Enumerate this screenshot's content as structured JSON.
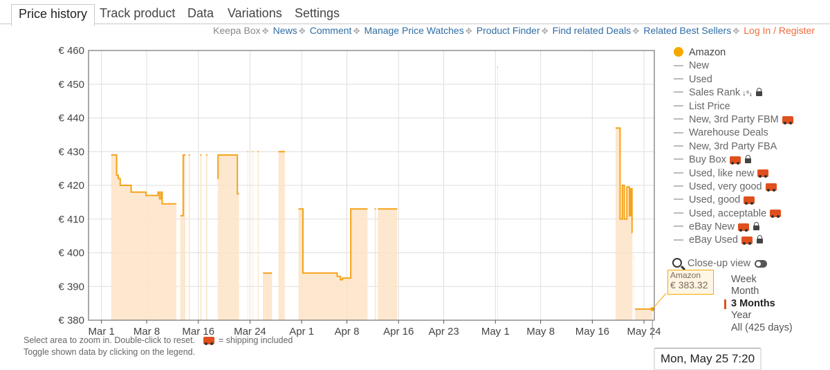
{
  "tabs": [
    "Price history",
    "Track product",
    "Data",
    "Variations",
    "Settings"
  ],
  "links": {
    "keepa_box": "Keepa Box",
    "items": [
      "News",
      "Comment",
      "Manage Price Watches",
      "Product Finder",
      "Find related Deals",
      "Related Best Sellers"
    ],
    "login": "Log In / Register"
  },
  "legend": {
    "items": [
      {
        "label": "Amazon",
        "selected": true
      },
      {
        "label": "New"
      },
      {
        "label": "Used"
      },
      {
        "label": "Sales Rank",
        "sort_icon": true,
        "lock": true
      },
      {
        "label": "List Price"
      },
      {
        "label": "New, 3rd Party FBM",
        "truck": true
      },
      {
        "label": "Warehouse Deals"
      },
      {
        "label": "New, 3rd Party FBA"
      },
      {
        "label": "Buy Box",
        "truck": true,
        "lock": true
      },
      {
        "label": "Used, like new",
        "truck": true
      },
      {
        "label": "Used, very good",
        "truck": true
      },
      {
        "label": "Used, good",
        "truck": true
      },
      {
        "label": "Used, acceptable",
        "truck": true
      },
      {
        "label": "eBay New",
        "truck": true,
        "lock": true
      },
      {
        "label": "eBay Used",
        "truck": true,
        "lock": true
      }
    ],
    "closeup_label": "Close-up view"
  },
  "ranges": {
    "items": [
      "Week",
      "Month",
      "3 Months",
      "Year",
      "All (425 days)"
    ],
    "selected": "3 Months"
  },
  "hints": {
    "line1a": "Select area to zoom in. Double-click to reset.",
    "line1b": "= shipping included",
    "line2": "Toggle shown data by clicking on the legend."
  },
  "tooltip": {
    "series": "Amazon",
    "value": "€ 383.32"
  },
  "crosshair_date": "Mon, May 25 7:20",
  "colors": {
    "amazon_line": "#f5a31a",
    "amazon_fill": "#fde3c6",
    "grid": "#dedede",
    "link": "#2f6da4",
    "login": "#ef6b3a"
  },
  "chart_data": {
    "type": "area",
    "series_name": "Amazon",
    "y_unit": "€",
    "ylim": [
      380,
      460
    ],
    "y_ticks": [
      "€ 460",
      "€ 450",
      "€ 440",
      "€ 430",
      "€ 420",
      "€ 410",
      "€ 400",
      "€ 390",
      "€ 380"
    ],
    "y_tick_values": [
      460,
      450,
      440,
      430,
      420,
      410,
      400,
      390,
      380
    ],
    "x_ticks": [
      {
        "label": "Mar 1",
        "day": 0
      },
      {
        "label": "Mar 8",
        "day": 7
      },
      {
        "label": "Mar 16",
        "day": 15
      },
      {
        "label": "Mar 24",
        "day": 23
      },
      {
        "label": "Apr 1",
        "day": 31
      },
      {
        "label": "Apr 8",
        "day": 38
      },
      {
        "label": "Apr 16",
        "day": 46
      },
      {
        "label": "Apr 23",
        "day": 53
      },
      {
        "label": "May 1",
        "day": 61
      },
      {
        "label": "May 8",
        "day": 68
      },
      {
        "label": "May 16",
        "day": 76
      },
      {
        "label": "May 24",
        "day": 84
      }
    ],
    "x_domain_days": [
      -2,
      85.6
    ],
    "segments": [
      [
        [
          1.5,
          429
        ],
        [
          2.3,
          429
        ],
        [
          2.35,
          423
        ],
        [
          2.6,
          422
        ],
        [
          2.9,
          420
        ],
        [
          4.5,
          420
        ],
        [
          4.6,
          418
        ],
        [
          6.8,
          418
        ],
        [
          6.9,
          417
        ],
        [
          8.1,
          417
        ]
      ],
      [
        [
          8.1,
          417
        ],
        [
          8.7,
          417
        ],
        [
          8.75,
          418
        ],
        [
          8.95,
          418
        ],
        [
          9.0,
          416
        ],
        [
          9.2,
          416
        ],
        [
          9.25,
          418
        ],
        [
          9.35,
          418
        ],
        [
          9.4,
          414.5
        ],
        [
          11.6,
          414.5
        ]
      ],
      [
        [
          12.2,
          411
        ],
        [
          12.6,
          411
        ],
        [
          12.65,
          429
        ],
        [
          13.0,
          429
        ]
      ],
      [
        [
          13.5,
          429
        ],
        [
          13.7,
          429
        ]
      ],
      [
        [
          15.3,
          429
        ],
        [
          15.5,
          429
        ]
      ],
      [
        [
          16.2,
          429
        ],
        [
          16.4,
          429
        ]
      ],
      [
        [
          18.0,
          422
        ],
        [
          18.05,
          429
        ],
        [
          21.0,
          429
        ],
        [
          21.05,
          417.5
        ],
        [
          21.3,
          417.5
        ]
      ],
      [
        [
          22.6,
          430
        ],
        [
          22.7,
          430
        ]
      ],
      [
        [
          23.4,
          430
        ],
        [
          23.5,
          430
        ]
      ],
      [
        [
          24.2,
          430
        ],
        [
          24.35,
          430
        ]
      ],
      [
        [
          25.0,
          394
        ],
        [
          26.4,
          394
        ]
      ],
      [
        [
          27.4,
          430
        ],
        [
          28.4,
          430
        ]
      ],
      [
        [
          30.5,
          413
        ],
        [
          31.1,
          413
        ],
        [
          31.2,
          394
        ],
        [
          36.4,
          394
        ],
        [
          36.5,
          393
        ],
        [
          37.0,
          392
        ],
        [
          37.3,
          392.5
        ],
        [
          38.5,
          392.5
        ],
        [
          38.6,
          413
        ],
        [
          41.2,
          413
        ]
      ],
      [
        [
          42.3,
          413
        ],
        [
          42.5,
          413
        ]
      ],
      [
        [
          42.8,
          413
        ],
        [
          45.8,
          413
        ]
      ],
      [
        [
          61.3,
          455
        ],
        [
          61.4,
          455
        ]
      ],
      [
        [
          79.6,
          437
        ],
        [
          80.2,
          437
        ],
        [
          80.3,
          410
        ],
        [
          80.6,
          410
        ],
        [
          80.65,
          420
        ],
        [
          80.9,
          420
        ],
        [
          80.95,
          410
        ],
        [
          81.3,
          410
        ],
        [
          81.35,
          419.5
        ],
        [
          81.7,
          419.5
        ],
        [
          81.75,
          411
        ],
        [
          81.9,
          411
        ],
        [
          81.95,
          419
        ],
        [
          82.1,
          419
        ],
        [
          82.15,
          406
        ],
        [
          82.2,
          406
        ]
      ],
      [
        [
          82.4,
          399
        ],
        [
          82.45,
          399
        ]
      ],
      [
        [
          82.6,
          383.3
        ],
        [
          85.3,
          383.3
        ]
      ]
    ]
  }
}
